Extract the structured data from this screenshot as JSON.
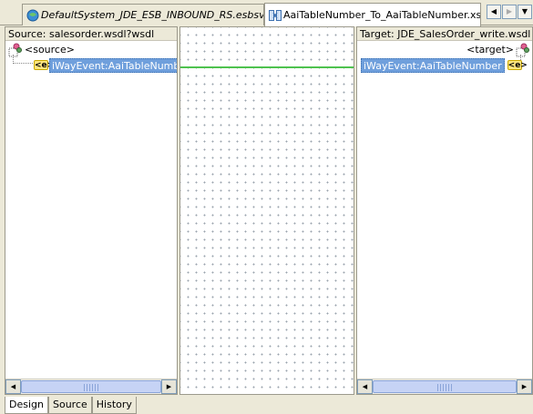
{
  "tabs": [
    {
      "label": "DefaultSystem_JDE_ESB_INBOUND_RS.esbsvc",
      "icon": "esb-service-icon"
    },
    {
      "label": "AaiTableNumber_To_AaiTableNumber.xsl",
      "icon": "xsl-map-icon"
    }
  ],
  "nav": {
    "prev": "◀",
    "next": "▶",
    "menu": "▼"
  },
  "left_pane": {
    "header": "Source: salesorder.wsdl?wsdl",
    "root": "<source>",
    "node_icon_text": "<e>",
    "node": "iWayEvent:AaiTableNumber"
  },
  "right_pane": {
    "header": "Target: JDE_SalesOrder_write.wsdl",
    "root": "<target>",
    "node_icon_text": "<e>",
    "node": "iWayEvent:AaiTableNumber"
  },
  "bottom_tabs": [
    "Design",
    "Source",
    "History"
  ],
  "scroll": {
    "left_arrow": "◀",
    "right_arrow": "▶"
  },
  "colors": {
    "link": "#4ec24e",
    "selection": "#6f9fdc"
  }
}
